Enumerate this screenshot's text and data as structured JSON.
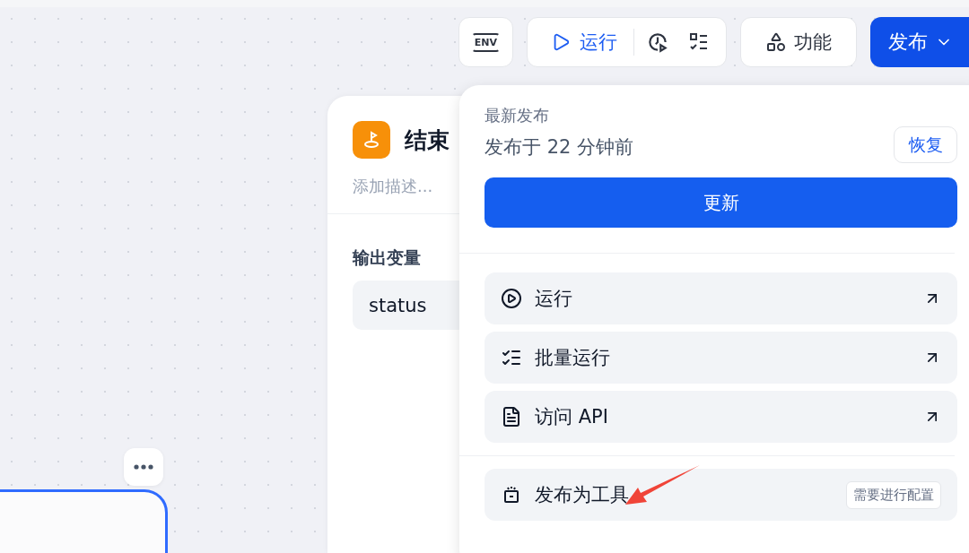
{
  "toolbar": {
    "env_label": "ENV",
    "run_button": "运行",
    "features_button": "功能",
    "publish_button": "发布"
  },
  "node_panel": {
    "title": "结束",
    "description_placeholder": "添加描述...",
    "section": "输出变量",
    "variables": [
      "status"
    ]
  },
  "publish_menu": {
    "heading": "最新发布",
    "published_time": "发布于 22 分钟前",
    "restore_button": "恢复",
    "update_button": "更新",
    "actions": [
      {
        "kind": "run",
        "label": "运行"
      },
      {
        "kind": "batch",
        "label": "批量运行"
      },
      {
        "kind": "api",
        "label": "访问 API"
      }
    ],
    "tool_action": {
      "label": "发布为工具",
      "badge": "需要进行配置"
    }
  }
}
